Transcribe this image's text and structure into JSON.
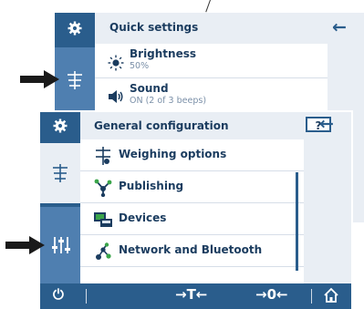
{
  "quick_settings": {
    "title": "Quick settings",
    "items": [
      {
        "icon": "brightness-icon",
        "label": "Brightness",
        "value": "50%"
      },
      {
        "icon": "sound-icon",
        "label": "Sound",
        "value": "ON (2 of 3 beeps)"
      }
    ]
  },
  "general_configuration": {
    "title": "General configuration",
    "help_label": "?",
    "items": [
      {
        "icon": "weighing-options-icon",
        "label": "Weighing options"
      },
      {
        "icon": "publishing-icon",
        "label": "Publishing"
      },
      {
        "icon": "devices-icon",
        "label": "Devices"
      },
      {
        "icon": "network-bluetooth-icon",
        "label": "Network and Bluetooth"
      }
    ]
  },
  "bottom_bar": {
    "power_label": "⏻",
    "tare_label": "→T←",
    "zero_label": "→0←"
  },
  "colors": {
    "primary": "#2a5d8c",
    "active": "#4f7fb0",
    "panel": "#e9eef4",
    "text": "#1b3c5f"
  }
}
